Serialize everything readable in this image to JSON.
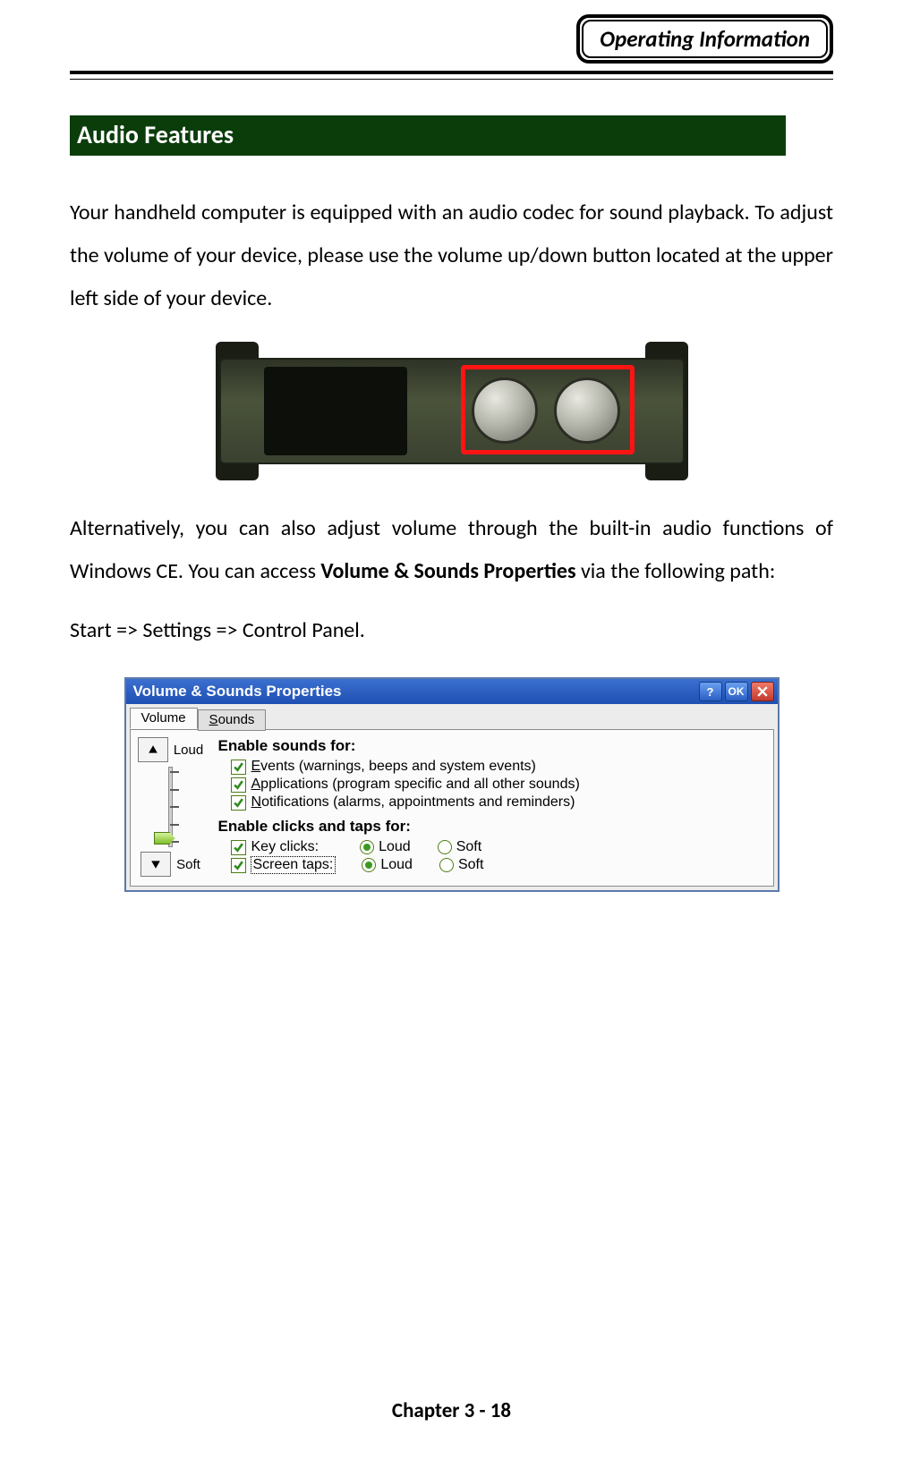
{
  "header": {
    "badge": "Operating Information"
  },
  "section_heading": "Audio Features",
  "para1": "Your handheld computer is equipped with an audio codec for sound playback. To adjust the volume of your device, please use the volume up/down button located at the upper left side of your device.",
  "para2a": "Alternatively, you can also adjust volume through the built-in audio functions of Windows CE. You can access ",
  "para2b_bold": "Volume & Sounds Properties",
  "para2c": " via the following path:",
  "para3_italic": "Start => Settings => Control Panel.",
  "dialog": {
    "title": "Volume & Sounds Properties",
    "help": "?",
    "ok": "OK",
    "tabs": {
      "volume": "Volume",
      "sounds": "Sounds",
      "sounds_ul": "S"
    },
    "slider": {
      "loud": "Loud",
      "soft": "Soft"
    },
    "heading_sounds": "Enable sounds for:",
    "checks": {
      "events": {
        "ul": "E",
        "rest": "vents (warnings, beeps and system events)"
      },
      "applications": {
        "ul": "A",
        "rest": "pplications (program specific and all other sounds)"
      },
      "notifications": {
        "ul": "N",
        "rest": "otifications (alarms, appointments and reminders)"
      }
    },
    "heading_clicks": "Enable clicks and taps for:",
    "clicks": {
      "key": {
        "ul": "K",
        "rest": "ey clicks:"
      },
      "screen": {
        "pre": "Screen ",
        "ul": "t",
        "rest": "aps:"
      }
    },
    "radios": {
      "loud": {
        "pre": "L",
        "ul": "o",
        "post": "ud"
      },
      "soft": {
        "pre": "So",
        "ul": "f",
        "post": "t"
      },
      "loud2": {
        "pre": "Lou",
        "ul": "d",
        "post": ""
      },
      "soft2": {
        "pre": "Sof",
        "ul": "t",
        "post": ""
      }
    }
  },
  "footer": "Chapter 3 - 18"
}
